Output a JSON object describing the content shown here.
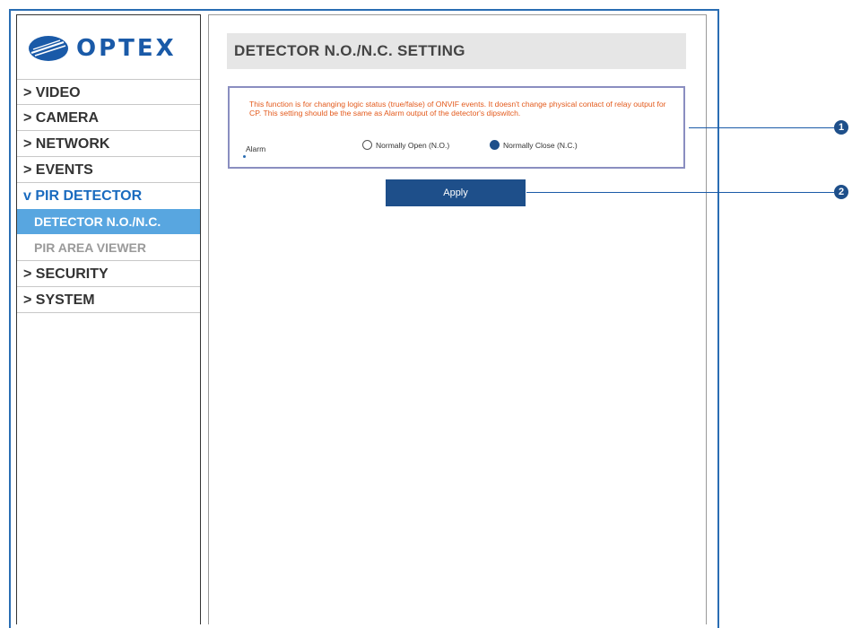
{
  "brand": {
    "logo_text": "OPTEX"
  },
  "sidebar": {
    "items": [
      {
        "label": "> VIDEO"
      },
      {
        "label": "> CAMERA"
      },
      {
        "label": "> NETWORK"
      },
      {
        "label": "> EVENTS"
      },
      {
        "label": "v PIR DETECTOR"
      },
      {
        "label": "DETECTOR N.O./N.C."
      },
      {
        "label": "PIR AREA VIEWER"
      },
      {
        "label": "> SECURITY"
      },
      {
        "label": "> SYSTEM"
      }
    ]
  },
  "main": {
    "title": "DETECTOR N.O./N.C. SETTING",
    "description": "This function is for changing logic status (true/false) of ONVIF events. It doesn't change physical contact of relay output for CP. This setting should be the same as Alarm output of the detector's dipswitch.",
    "alarm_label": "Alarm",
    "options": [
      {
        "label": "Normally Open (N.O.)",
        "selected": false
      },
      {
        "label": "Normally Close (N.C.)",
        "selected": true
      }
    ],
    "apply_label": "Apply"
  },
  "callouts": [
    {
      "number": "1"
    },
    {
      "number": "2"
    }
  ],
  "colors": {
    "brand_blue": "#1a5aa8",
    "selected_item": "#58a6e0",
    "apply_button": "#1e4f8a",
    "notice_text": "#e35a1c"
  }
}
